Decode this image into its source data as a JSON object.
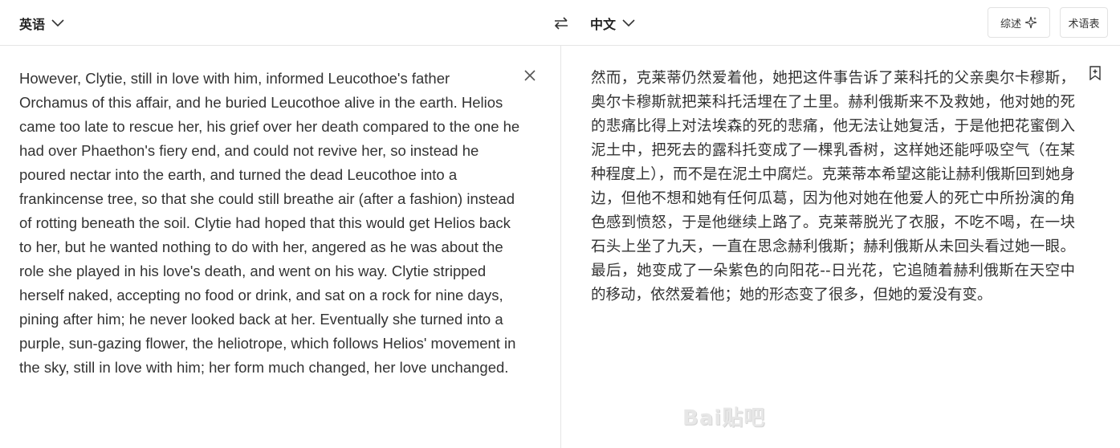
{
  "header": {
    "source_language": "英语",
    "target_language": "中文",
    "summary_label": "综述",
    "glossary_label": "术语表"
  },
  "source": {
    "text": "However, Clytie, still in love with him, informed Leucothoe's father Orchamus of this affair, and he buried Leucothoe alive in the earth. Helios came too late to rescue her, his grief over her death compared to the one he had over Phaethon's fiery end, and could not revive her, so instead he poured nectar into the earth, and turned the dead Leucothoe into a frankincense tree, so that she could still breathe air (after a fashion) instead of rotting beneath the soil. Clytie had hoped that this would get Helios back to her, but he wanted nothing to do with her, angered as he was about the role she played in his love's death, and went on his way. Clytie stripped herself naked, accepting no food or drink, and sat on a rock for nine days, pining after him; he never looked back at her. Eventually she turned into a purple, sun-gazing flower, the heliotrope, which follows Helios' movement in the sky, still in love with him; her form much changed, her love unchanged."
  },
  "translation": {
    "text": "然而，克莱蒂仍然爱着他，她把这件事告诉了莱科托的父亲奥尔卡穆斯，奥尔卡穆斯就把莱科托活埋在了土里。赫利俄斯来不及救她，他对她的死的悲痛比得上对法埃森的死的悲痛，他无法让她复活，于是他把花蜜倒入泥土中，把死去的露科托变成了一棵乳香树，这样她还能呼吸空气（在某种程度上），而不是在泥土中腐烂。克莱蒂本希望这能让赫利俄斯回到她身边，但他不想和她有任何瓜葛，因为他对她在他爱人的死亡中所扮演的角色感到愤怒，于是他继续上路了。克莱蒂脱光了衣服，不吃不喝，在一块石头上坐了九天，一直在思念赫利俄斯；赫利俄斯从未回头看过她一眼。最后，她变成了一朵紫色的向阳花--日光花，它追随着赫利俄斯在天空中的移动，依然爱着他；她的形态变了很多，但她的爱没有变。"
  },
  "watermark": "Bai贴吧",
  "icons": {
    "swap": "swap-arrows-icon",
    "clear": "close-icon",
    "bookmark": "bookmark-add-icon",
    "summary": "sparkle-icon",
    "chevron": "chevron-down-icon"
  }
}
